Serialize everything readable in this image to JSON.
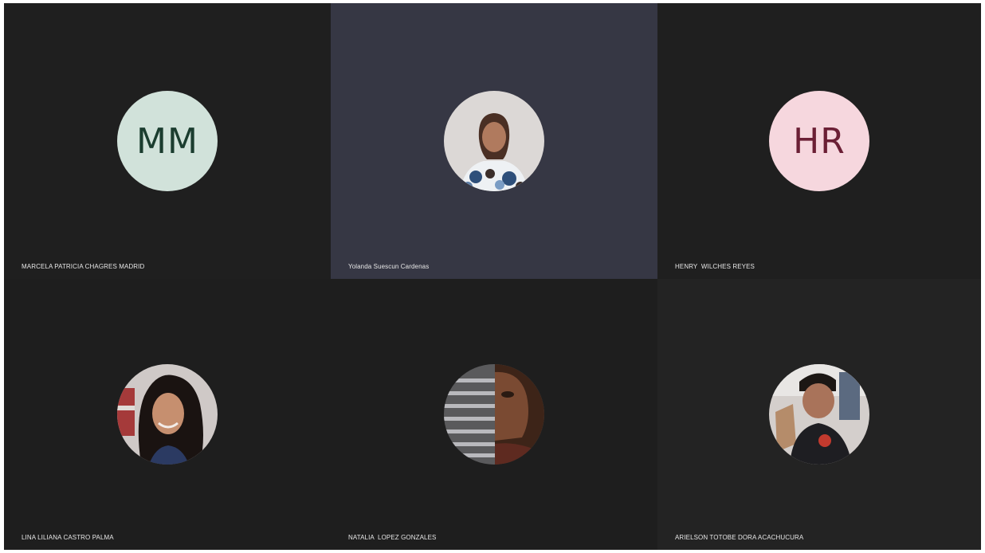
{
  "participants": [
    {
      "name": "MARCELA PATRICIA CHAGRES MADRID",
      "initials": "MM",
      "avatar_type": "initials",
      "avatar_bg": "#d1e2da",
      "initials_color": "#1b3d2f"
    },
    {
      "name": "Yolanda Suescun Cardenas",
      "avatar_type": "photo",
      "avatar_bg": "#d9d6d4",
      "active_speaker": true
    },
    {
      "name": "HENRY  WILCHES REYES",
      "initials": "HR",
      "avatar_type": "initials",
      "avatar_bg": "#f6d7de",
      "initials_color": "#6b1f35"
    },
    {
      "name": "LINA LILIANA CASTRO PALMA",
      "avatar_type": "photo",
      "avatar_bg": "#d0cac8"
    },
    {
      "name": "NATALIA  LOPEZ GONZALES",
      "avatar_type": "photo",
      "avatar_bg": "#8a7f78"
    },
    {
      "name": "ARIELSON TOTOBE DORA ACACHUCURA",
      "avatar_type": "photo",
      "avatar_bg": "#cfc9c6"
    }
  ],
  "colors": {
    "tile_bg": "#1f1f1f",
    "active_tile_bg": "#363744",
    "name_text": "#e6e6e6"
  }
}
